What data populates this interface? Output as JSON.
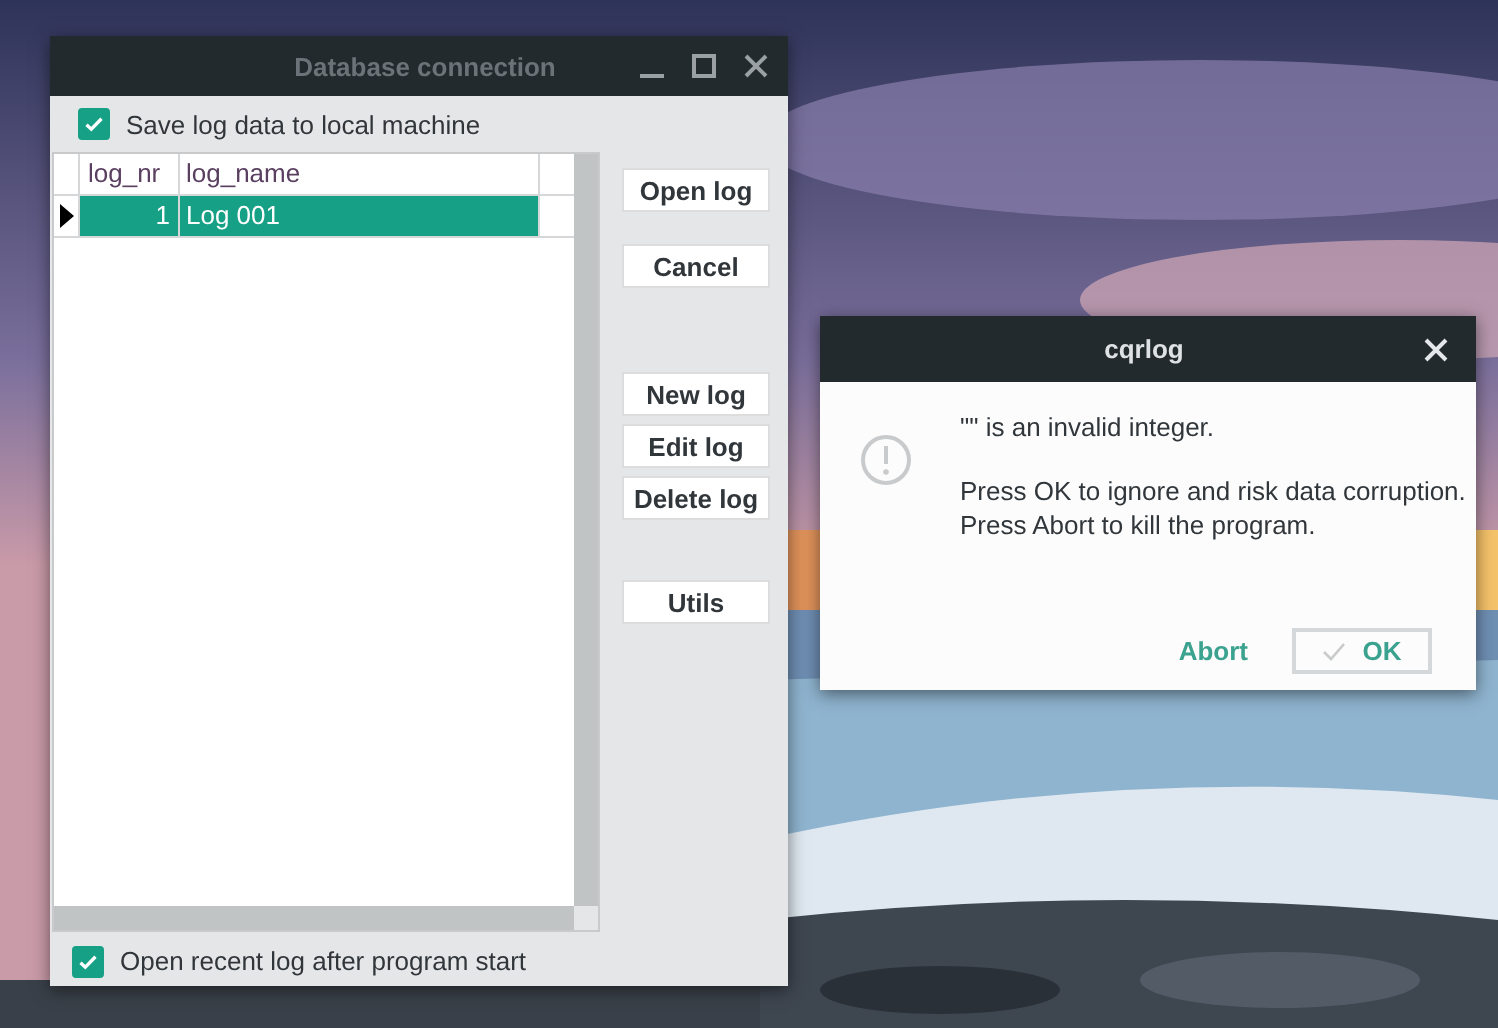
{
  "main_window": {
    "title": "Database connection",
    "save_log_checkbox": {
      "label": "Save log data to local machine",
      "checked": true
    },
    "log_table": {
      "columns": [
        "log_nr",
        "log_name"
      ],
      "rows": [
        {
          "cells": [
            "1",
            "Log 001"
          ],
          "selected": true
        }
      ]
    },
    "button_groups": [
      [
        "Open log"
      ],
      [
        "Cancel"
      ],
      [
        "New log",
        "Edit log",
        "Delete log"
      ],
      [
        "Utils"
      ]
    ],
    "open_recent_checkbox": {
      "label": "Open recent log after program start",
      "checked": true
    }
  },
  "dialog": {
    "title": "cqrlog",
    "message": "\"\" is an invalid integer.",
    "details": [
      "Press OK to ignore and risk data corruption.",
      "Press Abort to kill the program."
    ],
    "buttons": [
      {
        "label": "Abort",
        "kind": "flat"
      },
      {
        "label": "OK",
        "kind": "default"
      }
    ]
  }
}
